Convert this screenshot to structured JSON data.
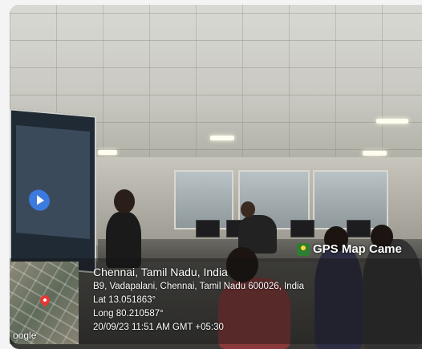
{
  "gps_badge": {
    "label": "GPS Map Came"
  },
  "location": {
    "city_line": "Chennai, Tamil Nadu, India",
    "address": "B9, Vadapalani, Chennai, Tamil Nadu 600026, India",
    "lat": "Lat 13.051863°",
    "long": "Long 80.210587°",
    "datetime": "20/09/23 11:51 AM GMT +05:30"
  },
  "map": {
    "label": "oogle"
  }
}
